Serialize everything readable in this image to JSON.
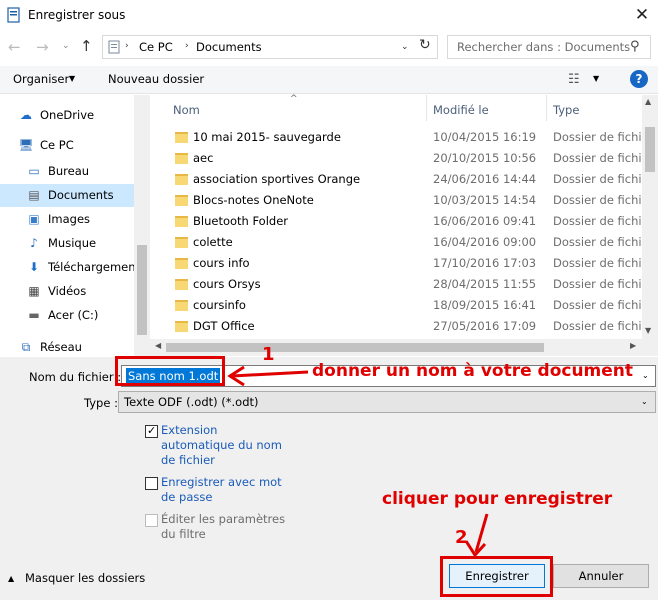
{
  "window": {
    "title": "Enregistrer sous",
    "close": "✕"
  },
  "nav": {
    "back": "←",
    "forward": "→",
    "recent": "⌄",
    "up": "↑"
  },
  "address": {
    "crumbs": [
      "Ce PC",
      "Documents"
    ],
    "sep": "›",
    "dropdown": "⌄",
    "refresh": "↻"
  },
  "search": {
    "placeholder": "Rechercher dans : Documents",
    "icon": "⚲"
  },
  "toolbar": {
    "organiser": "Organiser",
    "organiser_dd": "▼",
    "new_folder": "Nouveau dossier",
    "view": "☷",
    "view_dd": "▼",
    "help": "?"
  },
  "sidebar": {
    "items": [
      {
        "label": "OneDrive",
        "icon": "☁"
      },
      {
        "label": "Ce PC",
        "icon": "🖥"
      },
      {
        "label": "Bureau",
        "icon": "▭"
      },
      {
        "label": "Documents",
        "icon": "▤"
      },
      {
        "label": "Images",
        "icon": "▣"
      },
      {
        "label": "Musique",
        "icon": "♪"
      },
      {
        "label": "Téléchargement",
        "icon": "⬇"
      },
      {
        "label": "Vidéos",
        "icon": "▦"
      },
      {
        "label": "Acer (C:)",
        "icon": "▬"
      },
      {
        "label": "Réseau",
        "icon": "⧉"
      }
    ]
  },
  "list": {
    "sort_indicator": "^",
    "columns": {
      "name": "Nom",
      "modified": "Modifié le",
      "type": "Type"
    },
    "rows": [
      {
        "name": "10 mai 2015- sauvegarde",
        "date": "10/04/2015 16:19",
        "type": "Dossier de fichiers"
      },
      {
        "name": "aec",
        "date": "20/10/2015 10:56",
        "type": "Dossier de fichiers"
      },
      {
        "name": "association sportives Orange",
        "date": "24/06/2016 14:44",
        "type": "Dossier de fichiers"
      },
      {
        "name": "Blocs-notes OneNote",
        "date": "10/03/2015 14:54",
        "type": "Dossier de fichiers"
      },
      {
        "name": "Bluetooth Folder",
        "date": "16/06/2016 09:41",
        "type": "Dossier de fichiers"
      },
      {
        "name": "colette",
        "date": "16/04/2016 09:00",
        "type": "Dossier de fichiers"
      },
      {
        "name": "cours info",
        "date": "17/10/2016 17:03",
        "type": "Dossier de fichiers"
      },
      {
        "name": "cours Orsys",
        "date": "28/04/2015 11:55",
        "type": "Dossier de fichiers"
      },
      {
        "name": "coursinfo",
        "date": "18/09/2015 16:41",
        "type": "Dossier de fichiers"
      },
      {
        "name": "DGT Office",
        "date": "27/05/2016 17:09",
        "type": "Dossier de fichiers"
      }
    ],
    "scroll": {
      "up": "▲",
      "down": "▼",
      "left": "◀",
      "right": "▶"
    }
  },
  "form": {
    "filename_label": "Nom du fichier :",
    "filename_value": "Sans nom 1.odt",
    "type_label": "Type :",
    "type_value": "Texte ODF (.odt) (*.odt)",
    "dd": "⌄",
    "check_auto_ext": "Extension automatique du nom de fichier",
    "check_mark": "✓",
    "check_password": "Enregistrer avec mot de passe",
    "check_filter": "Éditer les paramètres du filtre",
    "hide_folders": "Masquer les dossiers",
    "hide_arrow": "▲",
    "save": "Enregistrer",
    "cancel": "Annuler"
  },
  "annotations": {
    "num1": "1",
    "text1": "donner un nom à votre document",
    "text2": "cliquer pour enregistrer",
    "num2": "2",
    "color": "#e00000"
  }
}
